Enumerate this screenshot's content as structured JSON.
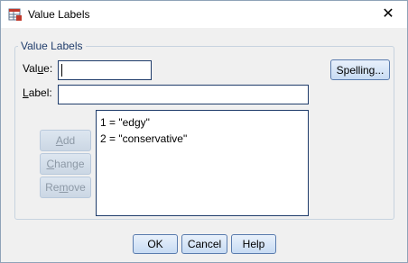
{
  "window": {
    "title": "Value Labels",
    "close_glyph": "✕"
  },
  "group": {
    "title": "Value Labels"
  },
  "value_field": {
    "label_prefix": "Val",
    "label_mnemonic": "u",
    "label_suffix": "e:",
    "value": ""
  },
  "label_field": {
    "label_mnemonic": "L",
    "label_suffix": "abel:",
    "value": ""
  },
  "buttons": {
    "spelling": "Spelling...",
    "add_mnemonic": "A",
    "add_rest": "dd",
    "change_mnemonic": "C",
    "change_rest": "hange",
    "remove_prefix": "Re",
    "remove_mnemonic": "m",
    "remove_rest": "ove",
    "ok": "OK",
    "cancel": "Cancel",
    "help": "Help"
  },
  "value_labels": [
    "1 = \"edgy\"",
    "2 = \"conservative\""
  ],
  "icons": {
    "app": "spss-value-labels-icon",
    "close": "close-icon"
  },
  "colors": {
    "accent_text": "#1f3c6b",
    "button_border": "#5a7cae"
  }
}
